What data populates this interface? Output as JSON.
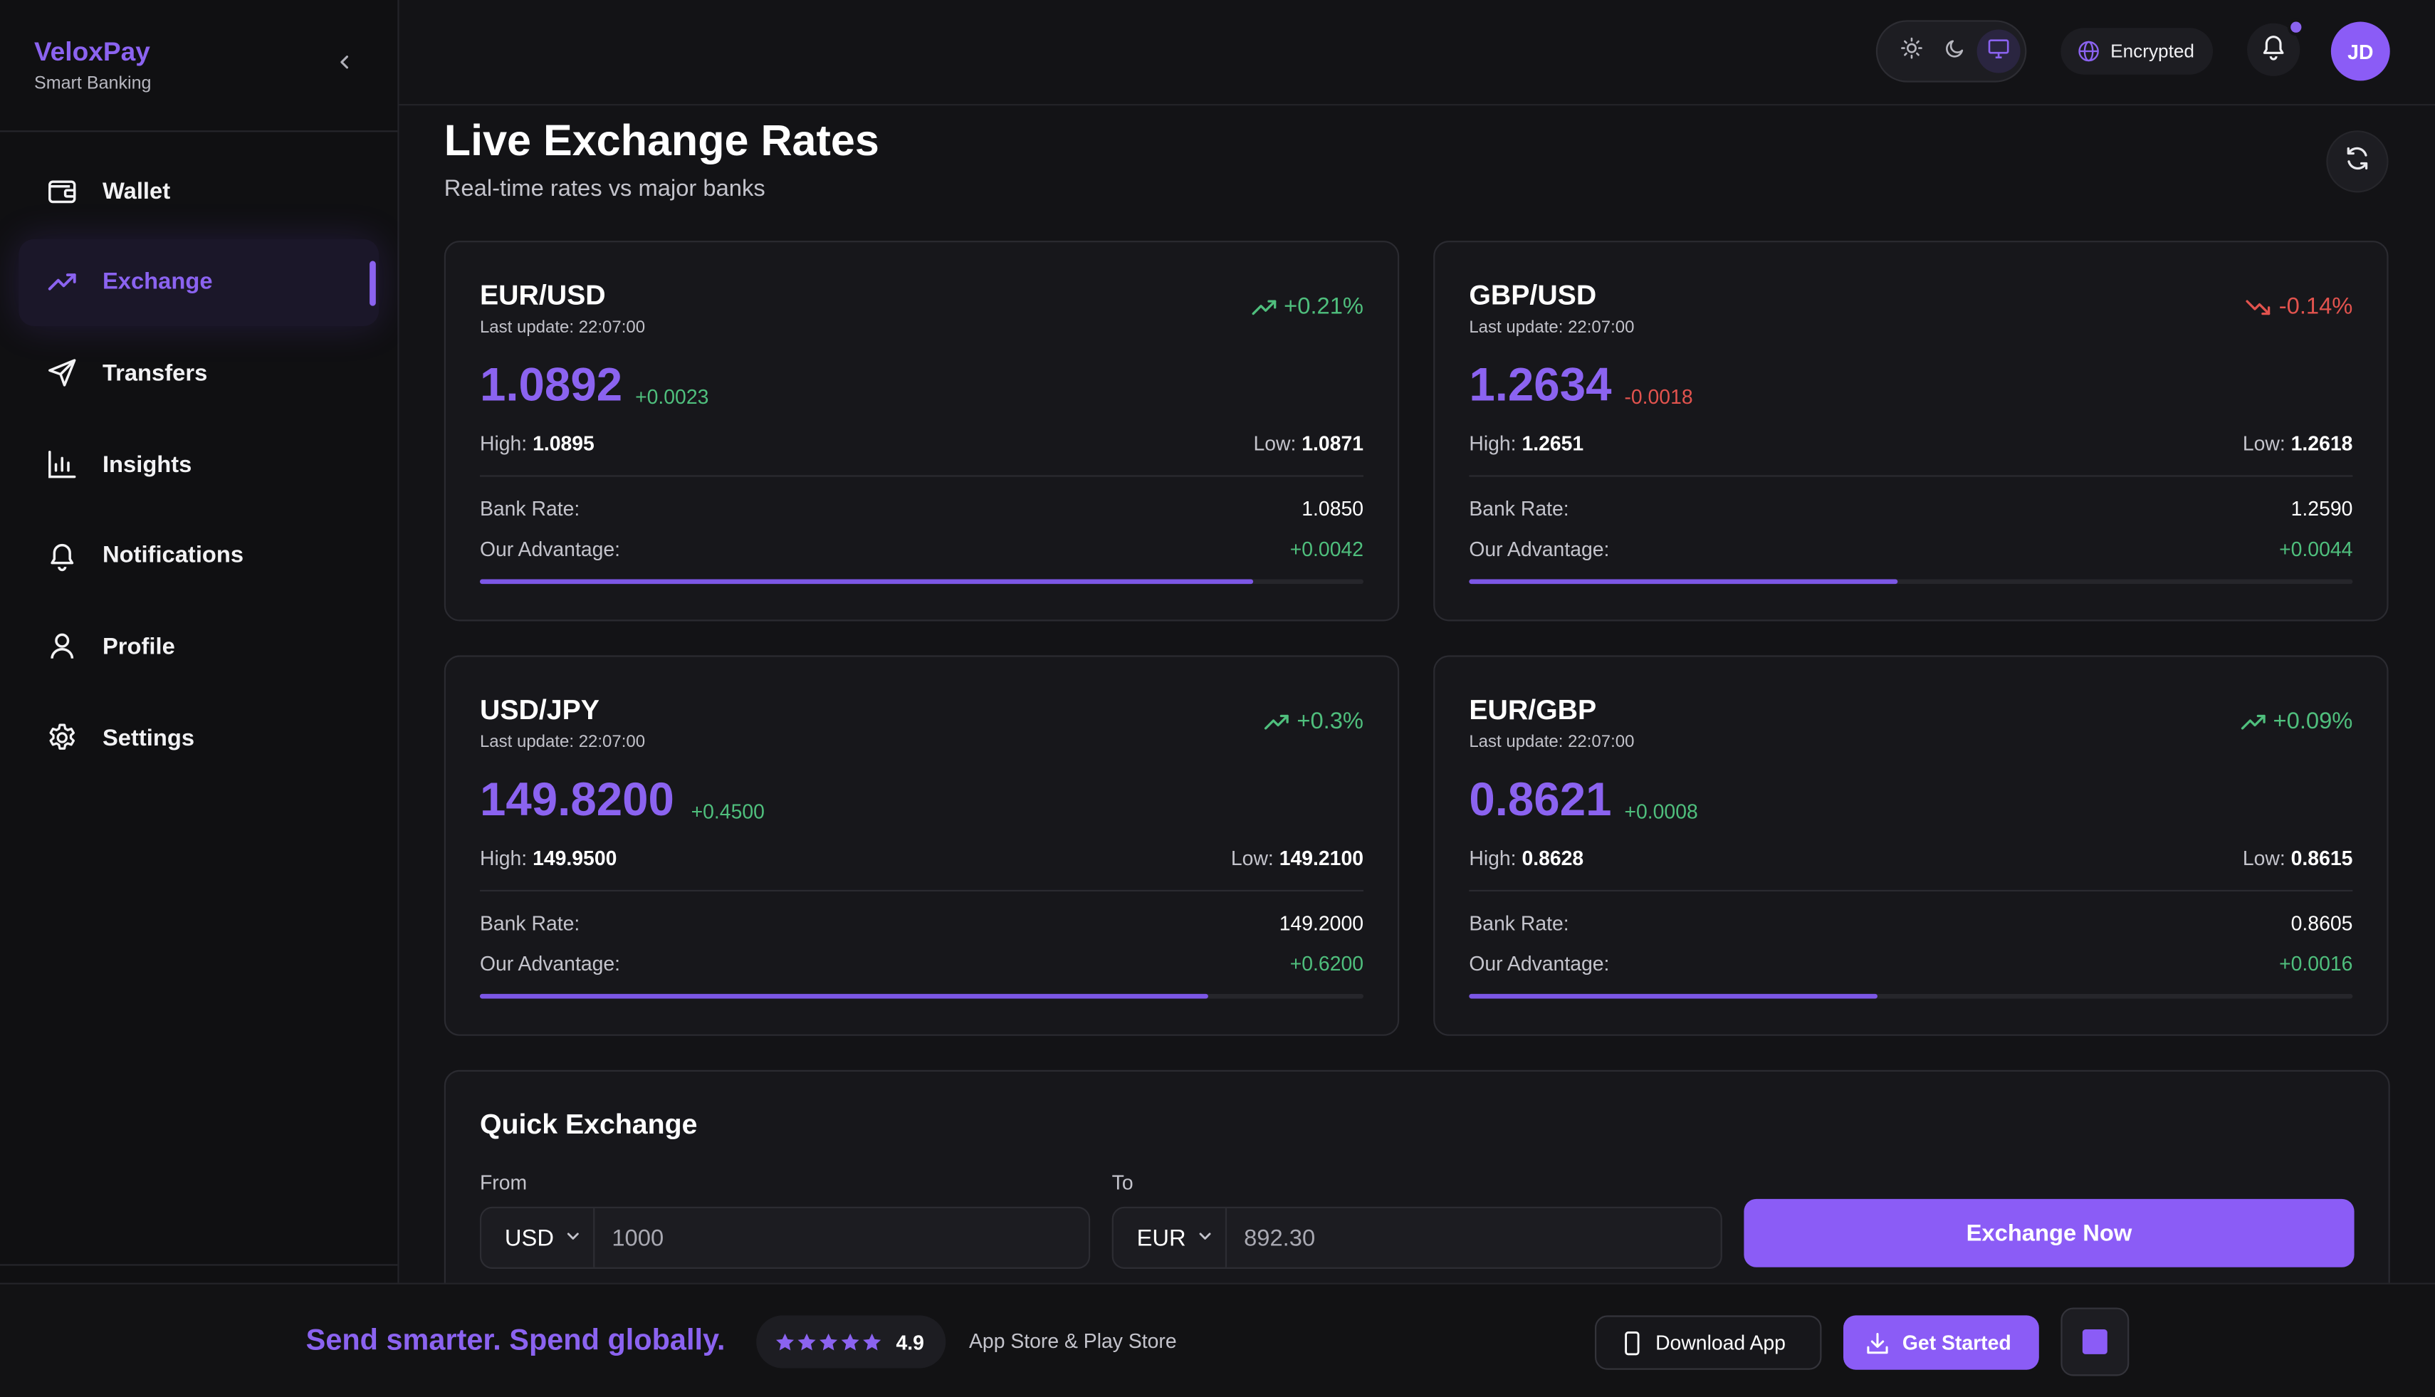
{
  "brand": {
    "name": "VeloxPay",
    "subtitle": "Smart Banking"
  },
  "sidebar": {
    "items": [
      {
        "label": "Wallet",
        "icon": "wallet-icon",
        "active": false
      },
      {
        "label": "Exchange",
        "icon": "trending-up-icon",
        "active": true
      },
      {
        "label": "Transfers",
        "icon": "send-icon",
        "active": false
      },
      {
        "label": "Insights",
        "icon": "bar-chart-icon",
        "active": false
      },
      {
        "label": "Notifications",
        "icon": "bell-icon",
        "active": false
      },
      {
        "label": "Profile",
        "icon": "user-icon",
        "active": false
      },
      {
        "label": "Settings",
        "icon": "gear-icon",
        "active": false
      }
    ]
  },
  "topbar": {
    "theme_options": [
      "light",
      "dark",
      "system"
    ],
    "theme_selected": "system",
    "security_label": "Encrypted",
    "has_unread_notifications": true,
    "avatar_initials": "JD"
  },
  "page": {
    "title": "Live Exchange Rates",
    "subtitle": "Real-time rates vs major banks"
  },
  "labels": {
    "high": "High:",
    "low": "Low:",
    "bank_rate": "Bank Rate:",
    "our_advantage": "Our Advantage:"
  },
  "rates": [
    {
      "pair": "EUR/USD",
      "last_update": "Last update: 22:07:00",
      "change_pct": "+0.21%",
      "direction": "up",
      "rate": "1.0892",
      "delta": "+0.0023",
      "high": "1.0895",
      "low": "1.0871",
      "bank_rate": "1.0850",
      "advantage": "+0.0042",
      "advantage_level": 0.875
    },
    {
      "pair": "GBP/USD",
      "last_update": "Last update: 22:07:00",
      "change_pct": "-0.14%",
      "direction": "down",
      "rate": "1.2634",
      "delta": "-0.0018",
      "high": "1.2651",
      "low": "1.2618",
      "bank_rate": "1.2590",
      "advantage": "+0.0044",
      "advantage_level": 0.485
    },
    {
      "pair": "USD/JPY",
      "last_update": "Last update: 22:07:00",
      "change_pct": "+0.3%",
      "direction": "up",
      "rate": "149.8200",
      "delta": "+0.4500",
      "high": "149.9500",
      "low": "149.2100",
      "bank_rate": "149.2000",
      "advantage": "+0.6200",
      "advantage_level": 0.825
    },
    {
      "pair": "EUR/GBP",
      "last_update": "Last update: 22:07:00",
      "change_pct": "+0.09%",
      "direction": "up",
      "rate": "0.8621",
      "delta": "+0.0008",
      "high": "0.8628",
      "low": "0.8615",
      "bank_rate": "0.8605",
      "advantage": "+0.0016",
      "advantage_level": 0.462
    }
  ],
  "quick_exchange": {
    "title": "Quick Exchange",
    "from_label": "From",
    "to_label": "To",
    "from_currency": "USD",
    "from_amount": "1000",
    "to_currency": "EUR",
    "to_amount": "892.30",
    "button": "Exchange Now"
  },
  "footer": {
    "tagline": "Send smarter. Spend globally.",
    "rating": "4.9",
    "stars": 5,
    "stores": "App Store & Play Store",
    "download_label": "Download App",
    "get_started_label": "Get Started"
  },
  "colors": {
    "accent": "#8b5cf6",
    "positive": "#4fbf7d",
    "negative": "#e2534e",
    "background": "#131316"
  }
}
